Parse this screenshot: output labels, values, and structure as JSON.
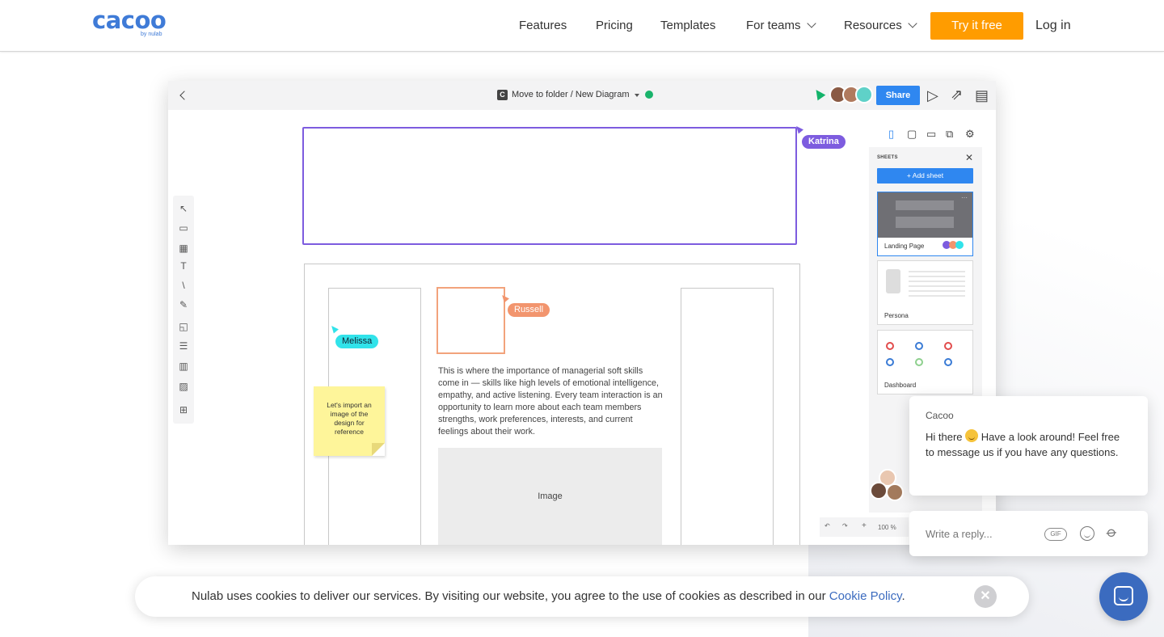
{
  "brand": {
    "logo": "cacoo",
    "by": "by nulab",
    "color": "#3f7bd7"
  },
  "nav": {
    "items": [
      {
        "label": "Features",
        "has_dropdown": false
      },
      {
        "label": "Pricing",
        "has_dropdown": false
      },
      {
        "label": "Templates",
        "has_dropdown": false
      },
      {
        "label": "For teams",
        "has_dropdown": true
      },
      {
        "label": "Resources",
        "has_dropdown": true
      }
    ],
    "cta": "Try it free",
    "cta_color": "#ff9c00",
    "login": "Log in"
  },
  "editor": {
    "breadcrumb": "Move to folder / New Diagram",
    "share_label": "Share",
    "share_color": "#2f87f0",
    "left_tools": [
      "select-icon",
      "container-icon",
      "shapes-icon",
      "text-icon",
      "line-icon",
      "pen-icon",
      "sticky-note-icon",
      "table-icon",
      "chart-icon",
      "image-icon",
      "comment-icon"
    ],
    "collaborators": [
      {
        "name": "Katrina",
        "color": "#7d5cdf"
      },
      {
        "name": "Russell",
        "color": "#f2956e"
      },
      {
        "name": "Melissa",
        "color": "#31e3ea"
      }
    ],
    "sticky_note": "Let's import an image of the design for reference",
    "body_text": "This is where the importance of managerial soft skills come in — skills like high levels of emotional intelligence, empathy, and active listening. Every team interaction is an opportunity to learn more about each team members strengths, work preferences, interests, and current feelings about their work.",
    "image_placeholder": "Image",
    "sheets": {
      "title": "SHEETS",
      "add_label": "+ Add sheet",
      "items": [
        {
          "name": "Landing Page"
        },
        {
          "name": "Persona"
        },
        {
          "name": "Dashboard"
        }
      ]
    },
    "zoom": "100 %"
  },
  "chat": {
    "from": "Cacoo",
    "message_before_emoji": "Hi there",
    "message_after_emoji": "Have a look around! Feel free to message us if you have any questions.",
    "reply_placeholder": "Write a reply...",
    "gif_label": "GIF"
  },
  "cookie": {
    "text": "Nulab uses cookies to deliver our services. By visiting our website, you agree to the use of cookies as described in our ",
    "link": "Cookie Policy",
    "suffix": "."
  }
}
